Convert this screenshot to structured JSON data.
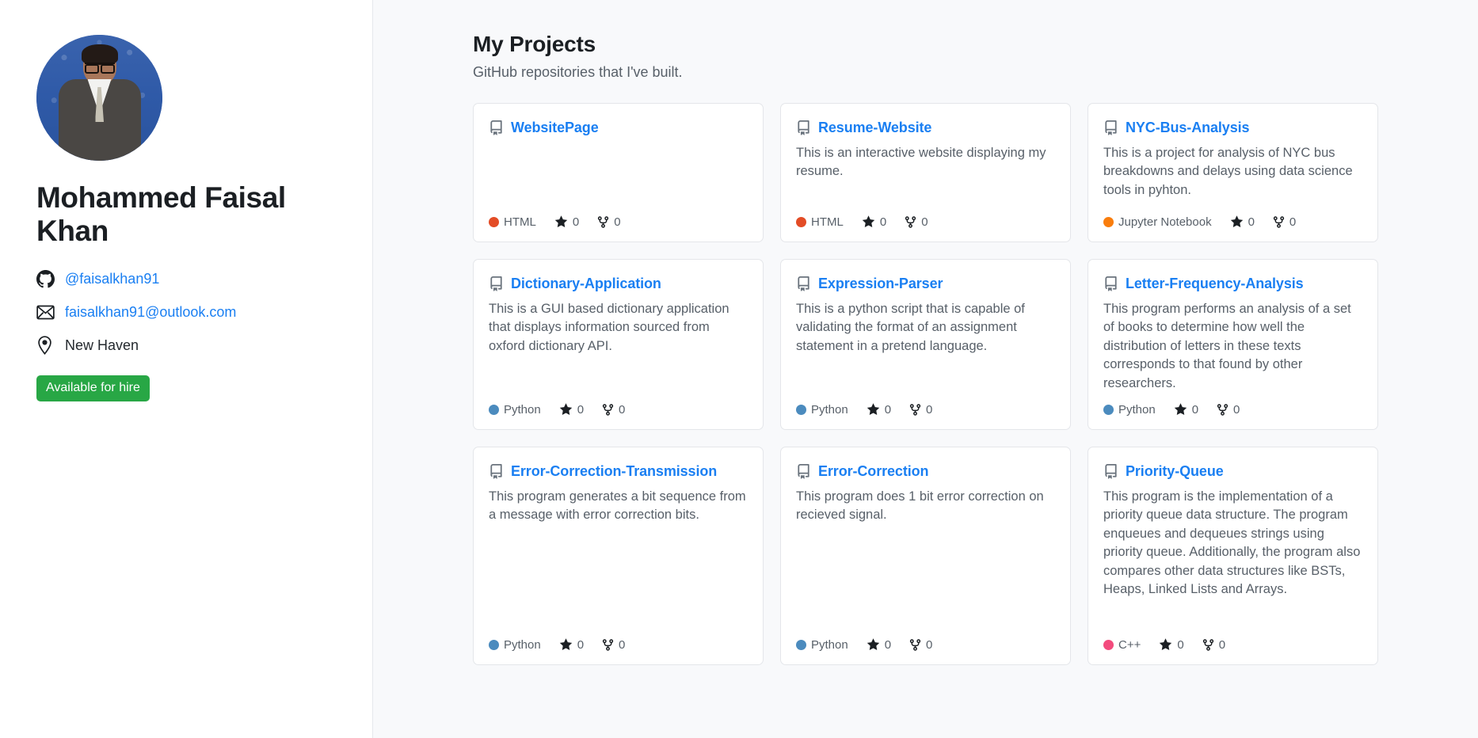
{
  "profile": {
    "avatar_alt": "profile-photo",
    "name": "Mohammed Faisal Khan",
    "github_handle": "@faisalkhan91",
    "email": "faisalkhan91@outlook.com",
    "location": "New Haven",
    "hire_badge": "Available for hire",
    "hire_badge_color": "#28a745",
    "link_color": "#1a7ff2"
  },
  "main": {
    "title": "My Projects",
    "subtitle": "GitHub repositories that I've built.",
    "projects": [
      {
        "name": "WebsitePage",
        "description": "",
        "language": "HTML",
        "language_color": "#e34c26",
        "stars": "0",
        "forks": "0"
      },
      {
        "name": "Resume-Website",
        "description": "This is an interactive website displaying my resume.",
        "language": "HTML",
        "language_color": "#e34c26",
        "stars": "0",
        "forks": "0"
      },
      {
        "name": "NYC-Bus-Analysis",
        "description": "This is a project for analysis of NYC bus breakdowns and delays using data science tools in pyhton.",
        "language": "Jupyter Notebook",
        "language_color": "#f97d0c",
        "stars": "0",
        "forks": "0"
      },
      {
        "name": "Dictionary-Application",
        "description": "This is a GUI based dictionary application that displays information sourced from oxford dictionary API.",
        "language": "Python",
        "language_color": "#4b8bbe",
        "stars": "0",
        "forks": "0"
      },
      {
        "name": "Expression-Parser",
        "description": "This is a python script that is capable of validating the format of an assignment statement in a pretend language.",
        "language": "Python",
        "language_color": "#4b8bbe",
        "stars": "0",
        "forks": "0"
      },
      {
        "name": "Letter-Frequency-Analysis",
        "description": "This program performs an analysis of a set of books to determine how well the distribution of letters in these texts corresponds to that found by other researchers.",
        "language": "Python",
        "language_color": "#4b8bbe",
        "stars": "0",
        "forks": "0"
      },
      {
        "name": "Error-Correction-Transmission",
        "description": "This program generates a bit sequence from a message with error correction bits.",
        "language": "Python",
        "language_color": "#4b8bbe",
        "stars": "0",
        "forks": "0"
      },
      {
        "name": "Error-Correction",
        "description": "This program does 1 bit error correction on recieved signal.",
        "language": "Python",
        "language_color": "#4b8bbe",
        "stars": "0",
        "forks": "0"
      },
      {
        "name": "Priority-Queue",
        "description": "This program is the implementation of a priority queue data structure. The program enqueues and dequeues strings using priority queue. Additionally, the program also compares other data structures like BSTs, Heaps, Linked Lists and Arrays.",
        "language": "C++",
        "language_color": "#f34b7d",
        "stars": "0",
        "forks": "0"
      }
    ]
  }
}
